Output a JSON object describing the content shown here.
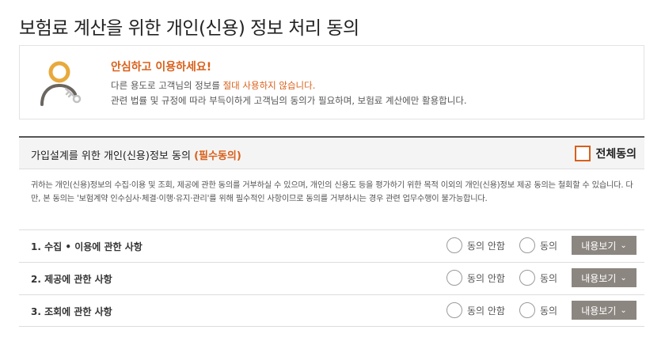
{
  "page_title": "보험료 계산을 위한 개인(신용) 정보 처리 동의",
  "notice": {
    "icon": "person-key-icon",
    "headline": "안심하고 이용하세요!",
    "line1_prefix": "다른 용도로 고객님의 정보를 ",
    "line1_highlight": "절대 사용하지 않습니다.",
    "line2": "관련 법률 및 규정에 따라 부득이하게 고객님의 동의가 필요하며, 보험료 계산에만 활용합니다."
  },
  "consent": {
    "title_prefix": "가입설계를 위한 개인(신용)정보 동의 ",
    "title_required": "(필수동의)",
    "all_agree_label": "전체동의",
    "description": "귀하는 개인(신용)정보의 수집·이용 및 조회, 제공에 관한 동의를 거부하실 수 있으며, 개인의 신용도 등을 평가하기 위한 목적 이외의 개인(신용)정보 제공 동의는 철회할 수 있습니다. 다만, 본 동의는 '보험계약 인수심사·체결·이행·유지·관리'를 위해 필수적인 사항이므로 동의를 거부하시는 경우 관련 업무수행이 불가능합니다."
  },
  "items": [
    {
      "label": "1. 수집 • 이용에 관한 사항",
      "disagree": "동의 안함",
      "agree": "동의",
      "view": "내용보기"
    },
    {
      "label": "2. 제공에 관한 사항",
      "disagree": "동의 안함",
      "agree": "동의",
      "view": "내용보기"
    },
    {
      "label": "3. 조회에 관한 사항",
      "disagree": "동의 안함",
      "agree": "동의",
      "view": "내용보기"
    }
  ],
  "colors": {
    "accent": "#d9601a",
    "button_bg": "#8c8680",
    "icon_ring": "#e8a93c",
    "icon_body": "#6b6560"
  }
}
